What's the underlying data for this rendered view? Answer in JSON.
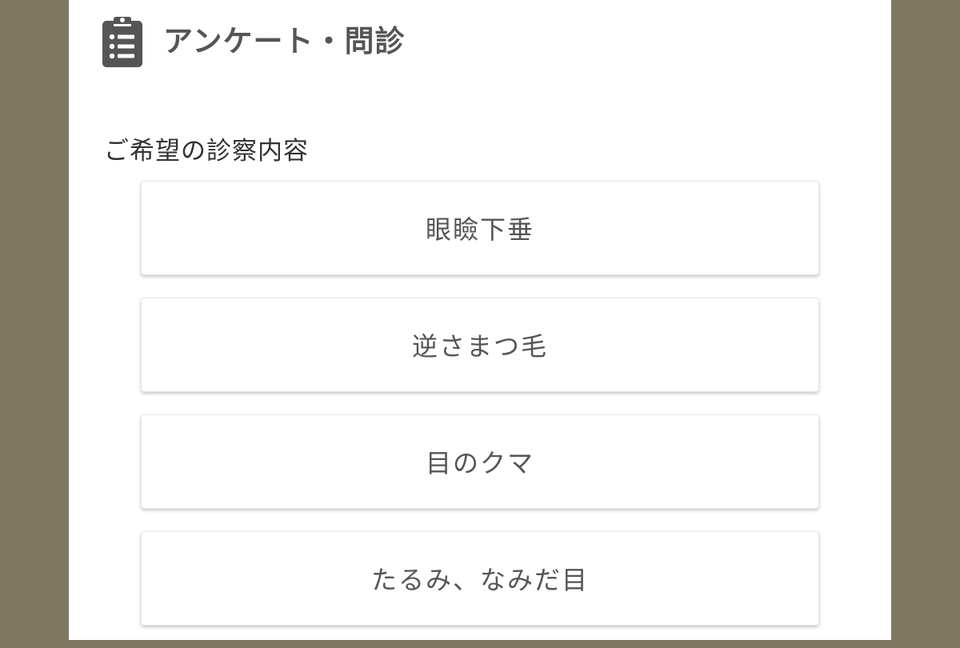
{
  "header": {
    "icon": "clipboard-list-icon",
    "title": "アンケート・問診"
  },
  "section": {
    "label": "ご希望の診察内容"
  },
  "options": [
    {
      "label": "眼瞼下垂"
    },
    {
      "label": "逆さまつ毛"
    },
    {
      "label": "目のクマ"
    },
    {
      "label": "たるみ、なみだ目"
    }
  ],
  "colors": {
    "background": "#7f775f",
    "panel": "#ffffff",
    "icon": "#555555",
    "text": "#555555"
  }
}
